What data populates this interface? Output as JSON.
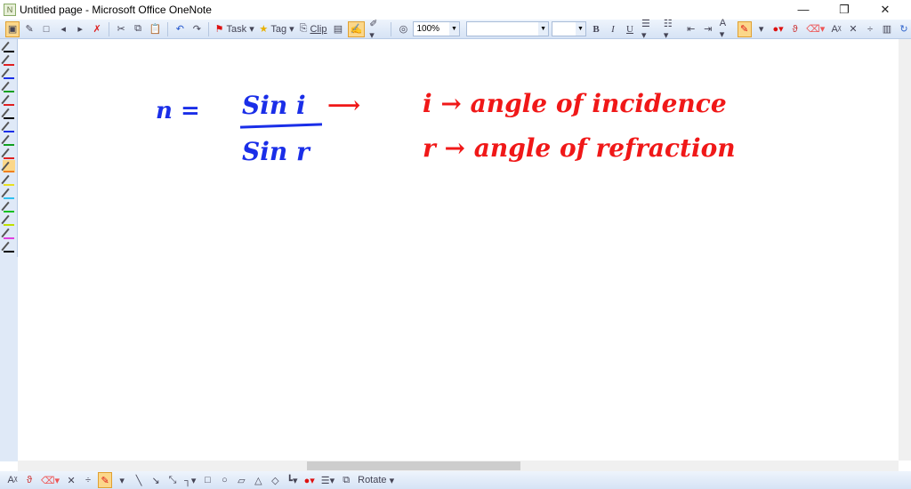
{
  "window": {
    "title": "Untitled page - Microsoft Office OneNote",
    "minimize": "—",
    "restore": "❐",
    "close": "✕"
  },
  "toolbar": {
    "task": "Task",
    "tag": "Tag",
    "clip": "Clip",
    "zoom": "100%",
    "font": "",
    "size": "",
    "bold": "B",
    "italic": "I",
    "underline": "U"
  },
  "drawing_toolbar": {
    "rotate": "Rotate"
  },
  "ink": {
    "eq_n": "n =",
    "numerator": "Sin i",
    "denominator": "Sin r",
    "line1": "i → angle of incidence",
    "line2": "r → angle of refraction"
  },
  "pen_colors": [
    "#000000",
    "#e02020",
    "#1a2ee8",
    "#10a020",
    "#e02020",
    "#000000",
    "#1a2ee8",
    "#10a020",
    "#e02020",
    "#f08020",
    "#e8e020",
    "#30c0f0",
    "#10c020",
    "#c0e000",
    "#e040e0",
    "#000000"
  ],
  "colors": {
    "ink_blue": "#1a2ee8",
    "ink_red": "#f01818",
    "accent": "#fbd78a"
  }
}
